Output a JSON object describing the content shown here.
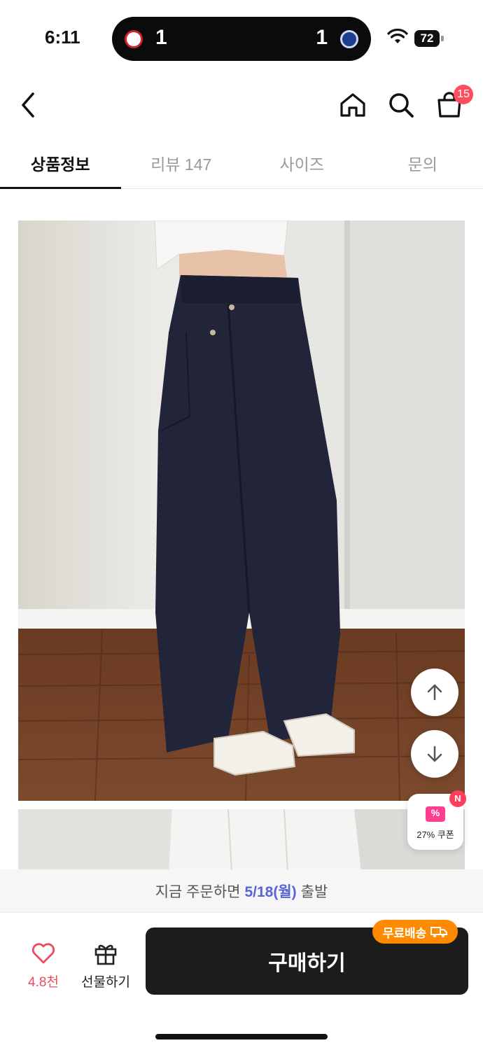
{
  "status_bar": {
    "time": "6:11",
    "live_activity": {
      "home_score": "1",
      "away_score": "1"
    },
    "battery": "72"
  },
  "nav": {
    "cart_count": "15"
  },
  "tabs": [
    {
      "label": "상품정보",
      "active": true
    },
    {
      "label": "리뷰 147",
      "active": false
    },
    {
      "label": "사이즈",
      "active": false
    },
    {
      "label": "문의",
      "active": false
    }
  ],
  "coupon": {
    "label": "27% 쿠폰",
    "badge": "N",
    "icon_text": "%"
  },
  "shipping_notice": {
    "prefix": "지금 주문하면",
    "date": "5/18(월)",
    "suffix": "출발"
  },
  "bottom_bar": {
    "like_count": "4.8천",
    "gift_label": "선물하기",
    "buy_label": "구매하기",
    "free_shipping": "무료배송"
  },
  "colors": {
    "accent_pink": "#ff4d5e",
    "shipping_date": "#5864d9",
    "free_shipping_orange": "#ff8a00",
    "buy_button": "#1c1c1c"
  }
}
